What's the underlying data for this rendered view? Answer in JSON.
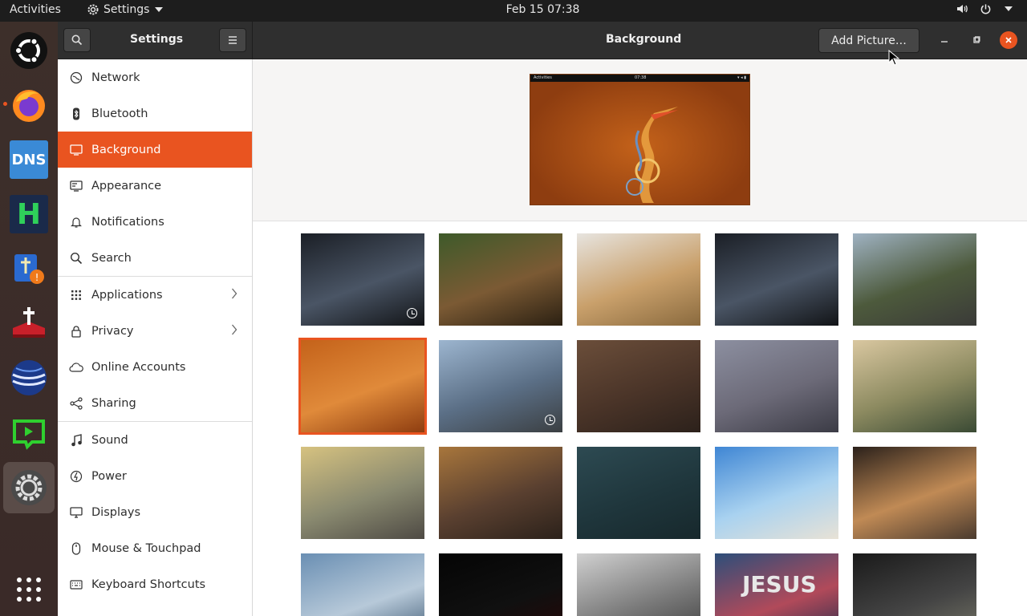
{
  "topbar": {
    "activities": "Activities",
    "app_menu": "Settings",
    "clock": "Feb 15  07:38"
  },
  "dock": {
    "items": [
      {
        "name": "ubuntu-logo-icon"
      },
      {
        "name": "firefox-icon"
      },
      {
        "name": "dns-icon",
        "label": "DNS"
      },
      {
        "name": "hexchat-icon",
        "label": "H"
      },
      {
        "name": "bible-study-icon"
      },
      {
        "name": "bible-app-icon"
      },
      {
        "name": "blue-app-icon"
      },
      {
        "name": "screen-recorder-icon"
      },
      {
        "name": "settings-app-icon"
      },
      {
        "name": "show-apps-icon"
      }
    ]
  },
  "headerbar": {
    "sidebar_title": "Settings",
    "page_title": "Background",
    "add_picture": "Add Picture…"
  },
  "sidebar": {
    "items": [
      {
        "label": "Network",
        "icon": "network-icon"
      },
      {
        "label": "Bluetooth",
        "icon": "bluetooth-icon"
      },
      {
        "label": "Background",
        "icon": "background-icon",
        "selected": true
      },
      {
        "label": "Appearance",
        "icon": "appearance-icon"
      },
      {
        "label": "Notifications",
        "icon": "bell-icon"
      },
      {
        "label": "Search",
        "icon": "search-icon"
      },
      {
        "label": "Applications",
        "icon": "apps-grid-icon"
      },
      {
        "label": "Privacy",
        "icon": "lock-icon"
      },
      {
        "label": "Online Accounts",
        "icon": "cloud-icon"
      },
      {
        "label": "Sharing",
        "icon": "share-icon"
      },
      {
        "label": "Sound",
        "icon": "music-note-icon"
      },
      {
        "label": "Power",
        "icon": "power-icon"
      },
      {
        "label": "Displays",
        "icon": "display-icon"
      },
      {
        "label": "Mouse & Touchpad",
        "icon": "mouse-icon"
      },
      {
        "label": "Keyboard Shortcuts",
        "icon": "keyboard-icon"
      }
    ]
  },
  "preview": {
    "mini_activities": "Activities",
    "mini_clock": "07:38"
  },
  "wallpapers": [
    {
      "name": "bridge-corridor-dark",
      "colors": [
        "#1b1f26",
        "#4a5565",
        "#121417"
      ],
      "badge": true
    },
    {
      "name": "forest-trees",
      "colors": [
        "#3e5a2a",
        "#7b5a34",
        "#2b2012"
      ]
    },
    {
      "name": "shuffleboard-table",
      "colors": [
        "#e7e4df",
        "#c9a06b",
        "#8a6a3e"
      ]
    },
    {
      "name": "bridge-corridor-dark-2",
      "colors": [
        "#1b1f26",
        "#4a5565",
        "#121417"
      ]
    },
    {
      "name": "suspension-bridge",
      "colors": [
        "#9fb2c2",
        "#4d5a3c",
        "#3a3a38"
      ]
    },
    {
      "name": "orange-heron",
      "colors": [
        "#c4621a",
        "#e08a3a",
        "#8e3d10"
      ],
      "selected": true
    },
    {
      "name": "man-on-rock",
      "colors": [
        "#9cb5cf",
        "#5b6f86",
        "#3b3f42"
      ],
      "badge": true
    },
    {
      "name": "wood-table-coffee",
      "colors": [
        "#6b4e3a",
        "#4a3428",
        "#2c211b"
      ]
    },
    {
      "name": "open-book-bokeh",
      "colors": [
        "#8c8fa0",
        "#6c6a78",
        "#3b3b45"
      ]
    },
    {
      "name": "green-mug-book",
      "colors": [
        "#d9c7a0",
        "#8c8a60",
        "#3a4a34"
      ]
    },
    {
      "name": "bible-on-path",
      "colors": [
        "#d6c280",
        "#8a8a70",
        "#4e4a44"
      ]
    },
    {
      "name": "bible-bokeh",
      "colors": [
        "#a8763c",
        "#5a4030",
        "#2b211a"
      ]
    },
    {
      "name": "bible-dark-teal",
      "colors": [
        "#2d4a52",
        "#1f363c",
        "#17282c"
      ]
    },
    {
      "name": "bible-on-beach",
      "colors": [
        "#3f86d4",
        "#a9d2f0",
        "#e8e2d6"
      ]
    },
    {
      "name": "sunset-mountains",
      "colors": [
        "#2b211b",
        "#c08a55",
        "#4a3a2e"
      ]
    },
    {
      "name": "sun-rays-lake",
      "colors": [
        "#6a8fb3",
        "#b7c9d9",
        "#35506a"
      ]
    },
    {
      "name": "black-red-cross",
      "colors": [
        "#050505",
        "#101010",
        "#2a0505"
      ]
    },
    {
      "name": "grey-geometric",
      "colors": [
        "#d0d0d0",
        "#7a7a7a",
        "#3a3a3a"
      ]
    },
    {
      "name": "jesus-text",
      "colors": [
        "#2d4e7a",
        "#b14a5a",
        "#1d2a4a"
      ],
      "label": "JESUS"
    },
    {
      "name": "worship-dark",
      "colors": [
        "#1a1a1a",
        "#444",
        "#7a7a6a"
      ]
    }
  ],
  "colors": {
    "accent": "#e95420",
    "topbar": "#1d1d1d",
    "headerbar": "#2f2f2f"
  }
}
